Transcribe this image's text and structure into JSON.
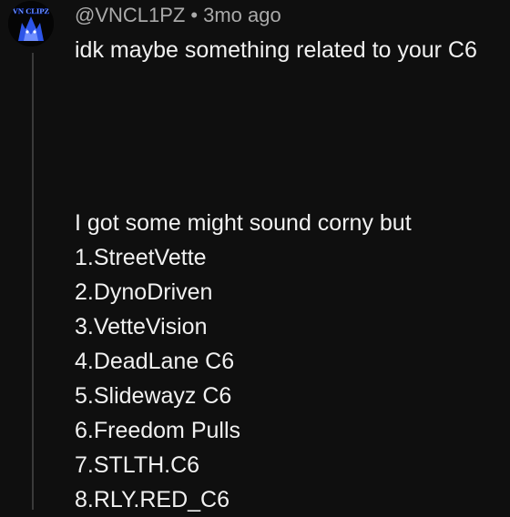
{
  "comment": {
    "username": "@VNCL1PZ",
    "separator": "•",
    "time_ago": "3mo ago",
    "avatar_text": "VN CLIPZ",
    "lines": [
      "idk maybe something related to your C6",
      "",
      "",
      "",
      "",
      "I got some might sound corny but",
      "1.StreetVette",
      "2.DynoDriven",
      "3.VetteVision",
      "4.DeadLane C6",
      "5.Slidewayz C6",
      "6.Freedom Pulls",
      "7.STLTH.C6",
      "8.RLY.RED_C6"
    ]
  },
  "colors": {
    "background": "#0f0f0f",
    "text": "#f1f1f1",
    "meta": "#aaaaaa",
    "thread_line": "#3a3a3a",
    "avatar_accent": "#3f6bff"
  },
  "icons": {
    "avatar": "wolf-logo-icon"
  }
}
